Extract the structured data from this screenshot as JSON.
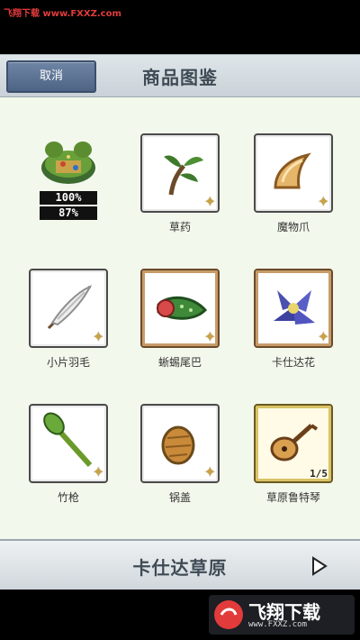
{
  "watermark": {
    "top_text": "飞翔下载 www.FXXZ.com",
    "badge_text": "飞翔下载",
    "badge_url": "www.FXXZ.com"
  },
  "header": {
    "cancel_label": "取消",
    "title": "商品图鉴"
  },
  "stats": {
    "line1": "100%",
    "line2": "87%"
  },
  "items": [
    {
      "label": "草药",
      "icon": "herb-icon"
    },
    {
      "label": "魔物爪",
      "icon": "claw-icon"
    },
    {
      "label": "小片羽毛",
      "icon": "feather-icon"
    },
    {
      "label": "蜥蜴尾巴",
      "icon": "lizard-tail-icon"
    },
    {
      "label": "卡仕达花",
      "icon": "flower-icon"
    },
    {
      "label": "竹枪",
      "icon": "bamboo-spear-icon"
    },
    {
      "label": "锅盖",
      "icon": "pot-lid-icon"
    },
    {
      "label": "草原鲁特琴",
      "icon": "lute-icon",
      "count": "1/5"
    }
  ],
  "footer": {
    "area_name": "卡仕达草原"
  },
  "colors": {
    "content_bg": "#f3f8ec",
    "button_blue": "#5a6f91",
    "title_text": "#3f4b55"
  }
}
